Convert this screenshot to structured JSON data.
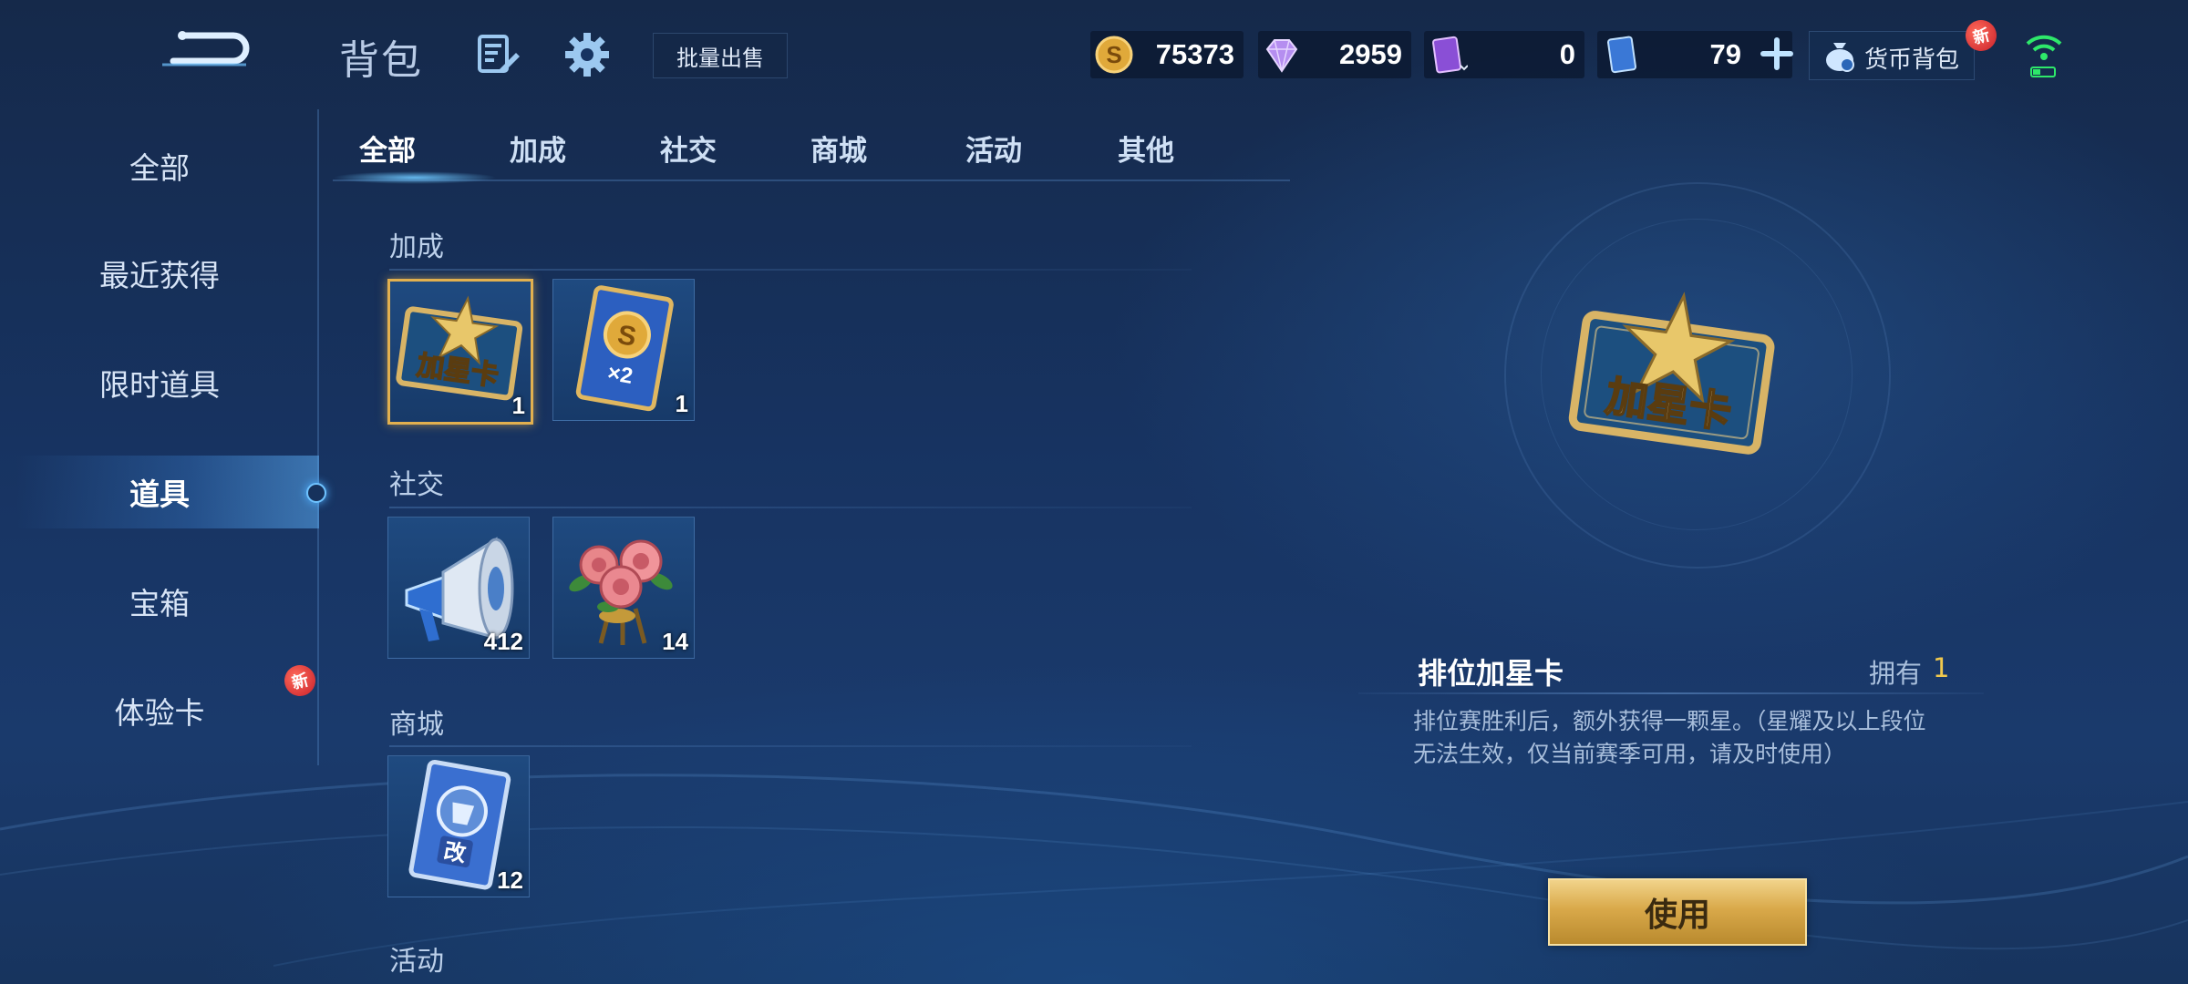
{
  "header": {
    "title": "背包",
    "batch_sell_label": "批量出售",
    "icons": [
      "back-arrow-icon",
      "edit-icon",
      "gear-icon",
      "wifi-icon"
    ]
  },
  "currencies": {
    "gold": {
      "value": "75373",
      "icon": "gold-coin-icon"
    },
    "gem": {
      "value": "2959",
      "icon": "diamond-icon"
    },
    "ticket": {
      "value": "0",
      "icon": "purple-card-icon"
    },
    "card": {
      "value": "79",
      "icon": "blue-card-icon"
    },
    "wallet_label": "货币背包",
    "new_badge": "新"
  },
  "sidebar": {
    "items": [
      {
        "label": "全部"
      },
      {
        "label": "最近获得"
      },
      {
        "label": "限时道具"
      },
      {
        "label": "道具",
        "active": true
      },
      {
        "label": "宝箱"
      },
      {
        "label": "体验卡",
        "new": "新"
      }
    ]
  },
  "tabs": [
    {
      "label": "全部",
      "active": true
    },
    {
      "label": "加成"
    },
    {
      "label": "社交"
    },
    {
      "label": "商城"
    },
    {
      "label": "活动"
    },
    {
      "label": "其他"
    }
  ],
  "sections": [
    {
      "title": "加成",
      "items": [
        {
          "name": "加星卡",
          "icon": "star-card-icon",
          "count": "1",
          "selected": true
        },
        {
          "name": "金币卡",
          "icon": "gold-x2-card-icon",
          "count": "1",
          "label": "×2"
        }
      ]
    },
    {
      "title": "社交",
      "items": [
        {
          "icon": "megaphone-icon",
          "count": "412"
        },
        {
          "icon": "rose-bouquet-icon",
          "count": "14"
        }
      ]
    },
    {
      "title": "商城",
      "items": [
        {
          "icon": "rename-card-icon",
          "count": "12",
          "label": "改"
        }
      ]
    },
    {
      "title": "活动",
      "items": []
    }
  ],
  "detail": {
    "icon_text": "加星卡",
    "name": "排位加星卡",
    "own_label": "拥有",
    "own_value": "1",
    "description": "排位赛胜利后，额外获得一颗星。（星耀及以上段位无法生效，仅当前赛季可用，请及时使用）",
    "use_label": "使用"
  },
  "colors": {
    "accent_gold": "#e2b04f",
    "own_value": "#f0c84d",
    "badge_red": "#c8202a"
  }
}
